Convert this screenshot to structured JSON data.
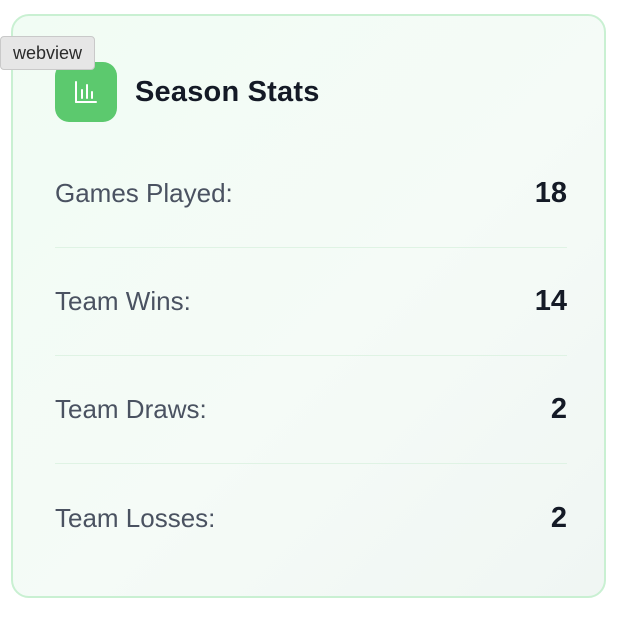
{
  "tooltip": {
    "text": "webview"
  },
  "card": {
    "title": "Season Stats",
    "icon": "bar-chart-icon",
    "accent_color": "#5cc96e",
    "stats": [
      {
        "label": "Games Played:",
        "value": "18"
      },
      {
        "label": "Team Wins:",
        "value": "14"
      },
      {
        "label": "Team Draws:",
        "value": "2"
      },
      {
        "label": "Team Losses:",
        "value": "2"
      }
    ]
  }
}
